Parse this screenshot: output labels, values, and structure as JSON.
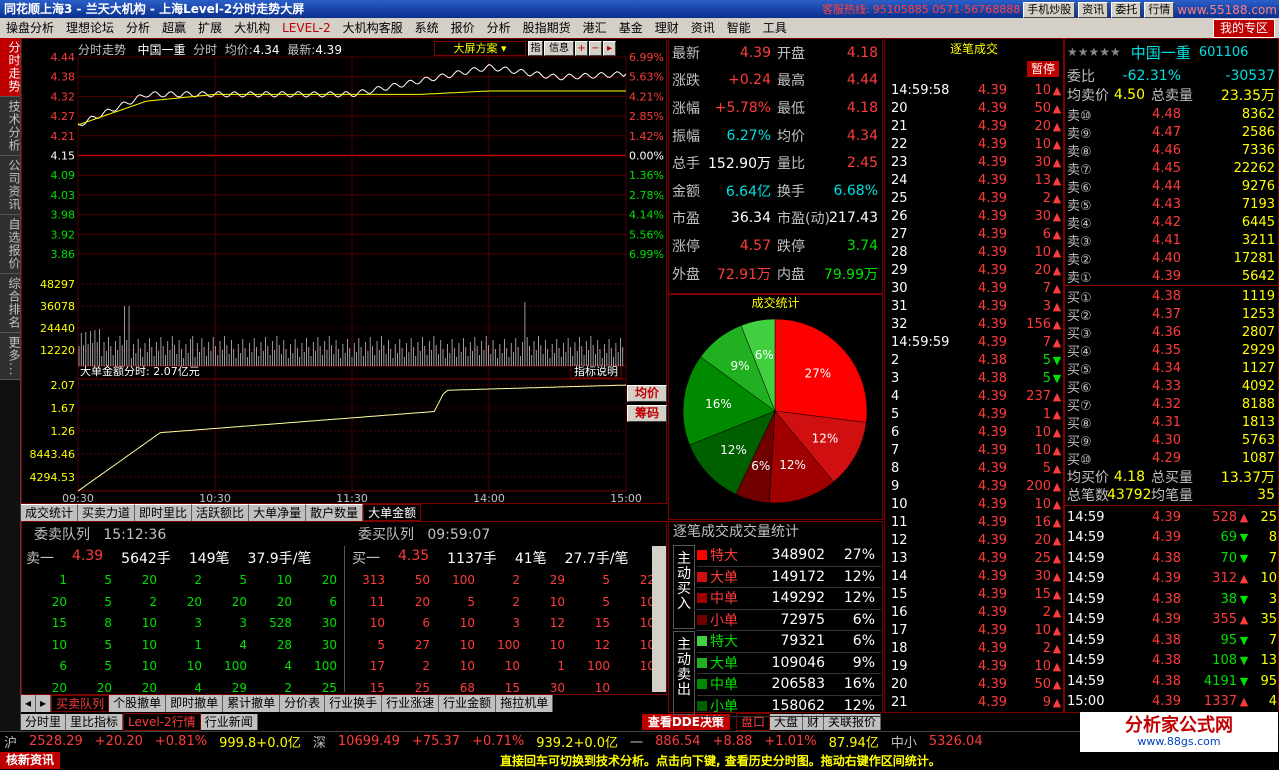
{
  "titlebar": {
    "app": "同花顺上海3",
    "sep1": " - ",
    "broker": "兰天大机构",
    "sep2": " - ",
    "view": "上海Level-2分时走势大屏",
    "hotline_label": "客服热线:",
    "hotline": "95105885 0571-56768888",
    "btn_phone": "手机炒股",
    "btn_news": "资讯",
    "btn_trade": "委托",
    "btn_quote": "行情",
    "site": "www.55188.com"
  },
  "menu": {
    "items": [
      "操盘分析",
      "理想论坛",
      "分析",
      "超赢",
      "扩展",
      "大机构",
      "LEVEL-2",
      "大机构客服",
      "系统",
      "报价",
      "分析",
      "股指期货",
      "港汇",
      "基金",
      "理财",
      "资讯",
      "智能",
      "工具"
    ],
    "login": "我的专区"
  },
  "sidebar": {
    "tabs": [
      "分时走势",
      "技术分析",
      "公司资讯",
      "自选报价",
      "综合排名",
      "更多..."
    ]
  },
  "chart": {
    "name": "中国一重",
    "kind": "分时",
    "avg_label": "均价:",
    "avg": "4.34",
    "last_label": "最新:",
    "last": "4.39",
    "title_label": "分时走势",
    "scheme": "大屏方案",
    "btn_ind": "指",
    "btn_info": "信息",
    "price_ticks": [
      "4.44",
      "4.38",
      "4.32",
      "4.27",
      "4.21",
      "4.15",
      "4.09",
      "4.03",
      "3.98",
      "3.92",
      "3.86"
    ],
    "pct_ticks": [
      "6.99%",
      "5.63%",
      "4.21%",
      "2.85%",
      "1.42%",
      "0.00%",
      "1.36%",
      "2.78%",
      "4.14%",
      "5.56%",
      "6.99%"
    ],
    "vol_ticks": [
      "48297",
      "36078",
      "24440",
      "12220"
    ],
    "big_label": "大单金额分时: 2.07亿元",
    "big_btn": "指标说明",
    "big_ticks": [
      "2.07",
      "1.67",
      "1.26",
      "8443.46",
      "4294.53"
    ],
    "time_ticks": [
      "09:30",
      "10:30",
      "11:30",
      "14:00",
      "15:00"
    ],
    "btn_avg": "均价",
    "btn_chip": "筹码"
  },
  "chart_data": {
    "type": "line",
    "x": [
      "09:30",
      "10:00",
      "10:30",
      "11:00",
      "11:30",
      "13:30",
      "14:00",
      "14:30",
      "15:00"
    ],
    "series": [
      {
        "name": "最新",
        "values": [
          4.24,
          4.33,
          4.33,
          4.33,
          4.33,
          4.37,
          4.41,
          4.38,
          4.39
        ]
      },
      {
        "name": "均价",
        "values": [
          4.24,
          4.31,
          4.33,
          4.33,
          4.33,
          4.33,
          4.34,
          4.34,
          4.34
        ]
      }
    ],
    "ylim": [
      3.86,
      4.44
    ]
  },
  "indicator_tabs": [
    "成交统计",
    "买卖力道",
    "即时里比",
    "活跃额比",
    "大单净量",
    "散户数量",
    "大单金额"
  ],
  "queue": {
    "sell_title": "委卖队列",
    "sell_time": "15:12:36",
    "buy_title": "委买队列",
    "buy_time": "09:59:07",
    "sell_top": {
      "lbl": "卖一",
      "price": "4.39",
      "vol": "5642手",
      "cnt": "149笔",
      "avg": "37.9手/笔"
    },
    "buy_top": {
      "lbl": "买一",
      "price": "4.35",
      "vol": "1137手",
      "cnt": "41笔",
      "avg": "27.7手/笔"
    },
    "sell_rows": [
      [
        "1",
        "5",
        "20",
        "2",
        "5",
        "10",
        "20"
      ],
      [
        "20",
        "5",
        "2",
        "20",
        "20",
        "20",
        "6"
      ],
      [
        "15",
        "8",
        "10",
        "3",
        "3",
        "528",
        "30"
      ],
      [
        "10",
        "5",
        "10",
        "1",
        "4",
        "28",
        "30"
      ],
      [
        "6",
        "5",
        "10",
        "10",
        "100",
        "4",
        "100"
      ],
      [
        "20",
        "20",
        "20",
        "4",
        "29",
        "2",
        "25"
      ]
    ],
    "buy_rows": [
      [
        "313",
        "50",
        "100",
        "2",
        "29",
        "5",
        "22"
      ],
      [
        "11",
        "20",
        "5",
        "2",
        "10",
        "5",
        "10"
      ],
      [
        "10",
        "6",
        "10",
        "3",
        "12",
        "15",
        "10"
      ],
      [
        "5",
        "27",
        "10",
        "100",
        "10",
        "12",
        "10"
      ],
      [
        "17",
        "2",
        "10",
        "10",
        "1",
        "100",
        "10"
      ],
      [
        "15",
        "25",
        "68",
        "15",
        "30",
        "10",
        ""
      ]
    ]
  },
  "bottom_tabs1": [
    "买卖队列",
    "个股撤单",
    "即时撤单",
    "累计撤单",
    "分价表",
    "行业换手",
    "行业涨速",
    "行业金额",
    "拖拉机单"
  ],
  "bottom_tabs2": {
    "items": [
      "分时里",
      "里比指标",
      "Level-2行情",
      "行业新闻"
    ],
    "ddx": "查看DDE决策",
    "right": [
      "盘口",
      "大盘",
      "财",
      "关联报价"
    ]
  },
  "quote": {
    "rows": [
      {
        "k": "最新",
        "v": "4.39",
        "k2": "开盘",
        "v2": "4.18"
      },
      {
        "k": "涨跌",
        "v": "+0.24",
        "k2": "最高",
        "v2": "4.44"
      },
      {
        "k": "涨幅",
        "v": "+5.78%",
        "k2": "最低",
        "v2": "4.18"
      },
      {
        "k": "振幅",
        "v": "6.27%",
        "k2": "均价",
        "v2": "4.34"
      },
      {
        "k": "总手",
        "v": "152.90万",
        "k2": "量比",
        "v2": "2.45"
      },
      {
        "k": "金额",
        "v": "6.64亿",
        "k2": "换手",
        "v2": "6.68%"
      },
      {
        "k": "市盈",
        "v": "36.34",
        "k2": "市盈(动)",
        "v2": "217.43"
      },
      {
        "k": "涨停",
        "v": "4.57",
        "k2": "跌停",
        "v2": "3.74"
      },
      {
        "k": "外盘",
        "v": "72.91万",
        "k2": "内盘",
        "v2": "79.99万"
      }
    ]
  },
  "pie": {
    "title": "成交统计",
    "slices": [
      {
        "label": "27%",
        "value": 27,
        "color": "#ff0000"
      },
      {
        "label": "12%",
        "value": 12,
        "color": "#d01010"
      },
      {
        "label": "12%",
        "value": 12,
        "color": "#a00000"
      },
      {
        "label": "6%",
        "value": 6,
        "color": "#700000"
      },
      {
        "label": "12%",
        "value": 12,
        "color": "#006000"
      },
      {
        "label": "16%",
        "value": 16,
        "color": "#008a00"
      },
      {
        "label": "9%",
        "value": 9,
        "color": "#20b020"
      },
      {
        "label": "6%",
        "value": 6,
        "color": "#40d040"
      }
    ]
  },
  "volstat": {
    "title": "逐笔成交成交量统计",
    "buy_group": "主动买入",
    "sell_group": "主动卖出",
    "buy": [
      {
        "lbl": "特大",
        "num": "348902",
        "pct": "27%",
        "color": "#ff0000"
      },
      {
        "lbl": "大单",
        "num": "149172",
        "pct": "12%",
        "color": "#d01010"
      },
      {
        "lbl": "中单",
        "num": "149292",
        "pct": "12%",
        "color": "#a00000"
      },
      {
        "lbl": "小单",
        "num": "72975",
        "pct": "6%",
        "color": "#700000"
      }
    ],
    "sell": [
      {
        "lbl": "特大",
        "num": "79321",
        "pct": "6%",
        "color": "#40d040"
      },
      {
        "lbl": "大单",
        "num": "109046",
        "pct": "9%",
        "color": "#20b020"
      },
      {
        "lbl": "中单",
        "num": "206583",
        "pct": "16%",
        "color": "#008a00"
      },
      {
        "lbl": "小单",
        "num": "158062",
        "pct": "12%",
        "color": "#006000"
      }
    ]
  },
  "ticks": {
    "title": "逐笔成交",
    "pause": "暂停",
    "rows": [
      [
        "14:59:58",
        "4.39",
        "10",
        "u"
      ],
      [
        "20",
        "4.39",
        "50",
        "u"
      ],
      [
        "21",
        "4.39",
        "20",
        "u"
      ],
      [
        "22",
        "4.39",
        "10",
        "u"
      ],
      [
        "23",
        "4.39",
        "30",
        "u"
      ],
      [
        "24",
        "4.39",
        "13",
        "u"
      ],
      [
        "25",
        "4.39",
        "2",
        "u"
      ],
      [
        "26",
        "4.39",
        "30",
        "u"
      ],
      [
        "27",
        "4.39",
        "6",
        "u"
      ],
      [
        "28",
        "4.39",
        "10",
        "u"
      ],
      [
        "29",
        "4.39",
        "20",
        "u"
      ],
      [
        "30",
        "4.39",
        "7",
        "u"
      ],
      [
        "31",
        "4.39",
        "3",
        "u"
      ],
      [
        "32",
        "4.39",
        "156",
        "u"
      ],
      [
        "14:59:59",
        "4.39",
        "7",
        "u"
      ],
      [
        "2",
        "4.38",
        "5",
        "d"
      ],
      [
        "3",
        "4.38",
        "5",
        "d"
      ],
      [
        "4",
        "4.39",
        "237",
        "u"
      ],
      [
        "5",
        "4.39",
        "1",
        "u"
      ],
      [
        "6",
        "4.39",
        "10",
        "u"
      ],
      [
        "7",
        "4.39",
        "10",
        "u"
      ],
      [
        "8",
        "4.39",
        "5",
        "u"
      ],
      [
        "9",
        "4.39",
        "200",
        "u"
      ],
      [
        "10",
        "4.39",
        "10",
        "u"
      ],
      [
        "11",
        "4.39",
        "16",
        "u"
      ],
      [
        "12",
        "4.39",
        "20",
        "u"
      ],
      [
        "13",
        "4.39",
        "25",
        "u"
      ],
      [
        "14",
        "4.39",
        "30",
        "u"
      ],
      [
        "15",
        "4.39",
        "15",
        "u"
      ],
      [
        "16",
        "4.39",
        "2",
        "u"
      ],
      [
        "17",
        "4.39",
        "10",
        "u"
      ],
      [
        "18",
        "4.39",
        "2",
        "u"
      ],
      [
        "19",
        "4.39",
        "10",
        "u"
      ],
      [
        "20",
        "4.39",
        "50",
        "u"
      ],
      [
        "21",
        "4.39",
        "9",
        "u"
      ]
    ]
  },
  "stock": {
    "stars": "★★★★★",
    "name": "中国一重",
    "code": "601106",
    "wb_label": "委比",
    "wb": "-62.31%",
    "wc": "-30537",
    "avg_sell_lbl": "均卖价",
    "avg_sell": "4.50",
    "total_sell_lbl": "总卖量",
    "total_sell": "23.35万",
    "sells": [
      [
        "卖⑩",
        "4.48",
        "8362"
      ],
      [
        "卖⑨",
        "4.47",
        "2586"
      ],
      [
        "卖⑧",
        "4.46",
        "7336"
      ],
      [
        "卖⑦",
        "4.45",
        "22262"
      ],
      [
        "卖⑥",
        "4.44",
        "9276"
      ],
      [
        "卖⑤",
        "4.43",
        "7193"
      ],
      [
        "卖④",
        "4.42",
        "6445"
      ],
      [
        "卖③",
        "4.41",
        "3211"
      ],
      [
        "卖②",
        "4.40",
        "17281"
      ],
      [
        "卖①",
        "4.39",
        "5642"
      ]
    ],
    "buys": [
      [
        "买①",
        "4.38",
        "1119"
      ],
      [
        "买②",
        "4.37",
        "1253"
      ],
      [
        "买③",
        "4.36",
        "2807"
      ],
      [
        "买④",
        "4.35",
        "2929"
      ],
      [
        "买⑤",
        "4.34",
        "1127"
      ],
      [
        "买⑥",
        "4.33",
        "4092"
      ],
      [
        "买⑦",
        "4.32",
        "8188"
      ],
      [
        "买⑧",
        "4.31",
        "1813"
      ],
      [
        "买⑨",
        "4.30",
        "5763"
      ],
      [
        "买⑩",
        "4.29",
        "1087"
      ]
    ],
    "avg_buy_lbl": "均买价",
    "avg_buy": "4.18",
    "total_buy_lbl": "总买量",
    "total_buy": "13.37万",
    "trades_lbl": "总笔数",
    "trades": "43792",
    "avg_vol_lbl": "均笔量",
    "avg_vol": "35",
    "recent": [
      [
        "14:59",
        "4.39",
        "528",
        "u",
        "25"
      ],
      [
        "14:59",
        "4.39",
        "69",
        "d",
        "8"
      ],
      [
        "14:59",
        "4.38",
        "70",
        "d",
        "7"
      ],
      [
        "14:59",
        "4.39",
        "312",
        "u",
        "10"
      ],
      [
        "14:59",
        "4.38",
        "38",
        "d",
        "3"
      ],
      [
        "14:59",
        "4.39",
        "355",
        "u",
        "35"
      ],
      [
        "14:59",
        "4.38",
        "95",
        "d",
        "7"
      ],
      [
        "14:59",
        "4.38",
        "108",
        "d",
        "13"
      ],
      [
        "14:59",
        "4.38",
        "4191",
        "d",
        "95"
      ],
      [
        "15:00",
        "4.39",
        "1337",
        "u",
        "4"
      ]
    ]
  },
  "status": {
    "sh_lbl": "沪",
    "sh": "2528.29",
    "sh_chg": "+20.20",
    "sh_pct": "+0.81%",
    "sh_amt": "999.8+0.0亿",
    "sz_lbl": "深",
    "sz": "10699.49",
    "sz_chg": "+75.37",
    "sz_pct": "+0.71%",
    "sz_amt": "939.2+0.0亿",
    "zx_lbl": "一",
    "zx": "886.54",
    "zx_chg": "+8.88",
    "zx_pct": "+1.01%",
    "zx_amt": "87.94亿",
    "zx2_lbl": "中小",
    "zx2": "5326.04"
  },
  "marquee": {
    "logo": "核新资讯",
    "text": "直接回车可切换到技术分析。点击向下键, 查看历史分时图。拖动右键作区间统计。"
  },
  "watermark": {
    "title": "分析家公式网",
    "url": "www.88gs.com"
  }
}
